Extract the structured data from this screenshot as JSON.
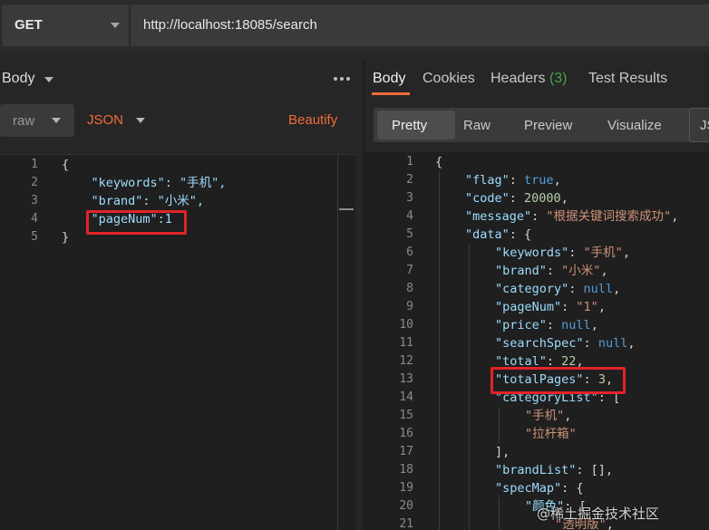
{
  "request": {
    "method": "GET",
    "url": "http://localhost:18085/search"
  },
  "left": {
    "body_label": "Body",
    "body_type": "raw",
    "format": "JSON",
    "beautify": "Beautify",
    "lines": [
      {
        "no": "1",
        "text": "{"
      },
      {
        "no": "2",
        "text": "    \"keywords\": \"手机\","
      },
      {
        "no": "3",
        "text": "    \"brand\": \"小米\","
      },
      {
        "no": "4",
        "text": "    \"pageNum\":1"
      },
      {
        "no": "5",
        "text": "}"
      }
    ]
  },
  "right": {
    "tabs": {
      "body": "Body",
      "cookies": "Cookies",
      "headers": "Headers",
      "headers_count": "(3)",
      "tests": "Test Results"
    },
    "views": {
      "pretty": "Pretty",
      "raw": "Raw",
      "preview": "Preview",
      "visualize": "Visualize",
      "js": "JS"
    },
    "lines": [
      {
        "no": "1"
      },
      {
        "no": "2"
      },
      {
        "no": "3"
      },
      {
        "no": "4"
      },
      {
        "no": "5"
      },
      {
        "no": "6"
      },
      {
        "no": "7"
      },
      {
        "no": "8"
      },
      {
        "no": "9"
      },
      {
        "no": "10"
      },
      {
        "no": "11"
      },
      {
        "no": "12"
      },
      {
        "no": "13"
      },
      {
        "no": "14"
      },
      {
        "no": "15"
      },
      {
        "no": "16"
      },
      {
        "no": "17"
      },
      {
        "no": "18"
      },
      {
        "no": "19"
      },
      {
        "no": "20"
      },
      {
        "no": "21"
      }
    ],
    "json": {
      "flag": "true",
      "code": "20000",
      "message": "\"根据关键词搜索成功\"",
      "keywords": "\"手机\"",
      "brand": "\"小米\"",
      "category": "null",
      "pageNum": "\"1\"",
      "price": "null",
      "searchSpec": "null",
      "total": "22",
      "totalPages": "3",
      "categoryList_0": "\"手机\"",
      "categoryList_1": "\"拉杆箱\"",
      "color_0": "\"透明版\""
    }
  },
  "watermark": "@稀土掘金技术社区",
  "colors": {
    "accent": "#f26b3a",
    "highlight": "#e3232a",
    "headers_count": "#49a04b"
  }
}
